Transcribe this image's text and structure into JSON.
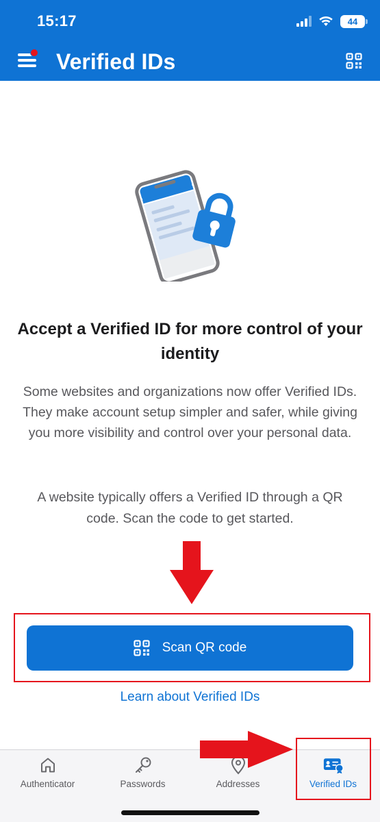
{
  "status_bar": {
    "time": "15:17",
    "battery": "44"
  },
  "header": {
    "title": "Verified IDs",
    "menu_icon": "hamburger-menu-icon",
    "qr_icon": "qr-code-icon"
  },
  "main": {
    "illustration": "phone-with-lock-illustration",
    "heading": "Accept a Verified ID for more control of your identity",
    "description": "Some websites and organizations now offer Verified IDs. They make account setup simpler and safer, while giving you more visibility and control over your personal data.",
    "description_2": "A website typically offers a Verified ID through a QR code. Scan the code to get started.",
    "scan_button_label": "Scan QR code",
    "learn_link": "Learn about Verified IDs"
  },
  "tabs": [
    {
      "label": "Authenticator",
      "icon": "home-icon",
      "active": false
    },
    {
      "label": "Passwords",
      "icon": "key-icon",
      "active": false
    },
    {
      "label": "Addresses",
      "icon": "location-pin-icon",
      "active": false
    },
    {
      "label": "Verified IDs",
      "icon": "verified-id-card-icon",
      "active": true
    }
  ],
  "colors": {
    "brand_blue": "#0f73d4",
    "annotation_red": "#e5141c",
    "notification_dot": "#e5141c"
  }
}
